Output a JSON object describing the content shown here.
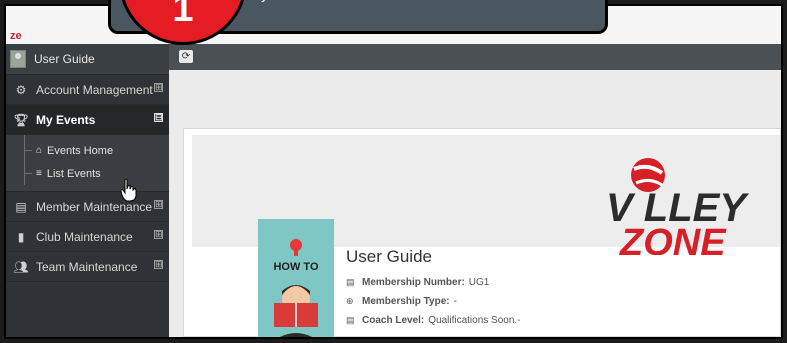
{
  "brand": {
    "mark": "ze"
  },
  "callout": {
    "number": "1",
    "text": "y"
  },
  "sidebar": {
    "user_name": "User Guide",
    "items": [
      {
        "label": "Account Management",
        "icon": "gears-icon",
        "toggle": "⊞"
      },
      {
        "label": "My Events",
        "icon": "trophy-icon",
        "toggle": "⊟",
        "active": true
      },
      {
        "label": "Member Maintenance",
        "icon": "id-card-icon",
        "toggle": "⊞"
      },
      {
        "label": "Club Maintenance",
        "icon": "building-icon",
        "toggle": "⊞"
      },
      {
        "label": "Team Maintenance",
        "icon": "users-icon",
        "toggle": "⊞"
      }
    ],
    "subitems": [
      {
        "label": "Events Home",
        "icon": "home-icon"
      },
      {
        "label": "List Events",
        "icon": "list-icon"
      }
    ]
  },
  "toolbar": {
    "refresh_icon": "refresh-icon"
  },
  "banner": {
    "logo_top": "V  LLEY",
    "logo_bottom": "ZONE"
  },
  "guide": {
    "image_text": "HOW TO"
  },
  "profile": {
    "title": "User Guide",
    "membership_number_label": "Membership Number:",
    "membership_number": "UG1",
    "membership_type_label": "Membership Type:",
    "membership_type": "-",
    "coach_level_label": "Coach Level:",
    "coach_level": "Qualifications Soon.-"
  },
  "colors": {
    "sidebar_bg": "#2f3337",
    "toolbar_bg": "#4b5054",
    "callout_bg": "#4a5761",
    "badge_red": "#e51c23",
    "logo_red": "#d62027"
  }
}
